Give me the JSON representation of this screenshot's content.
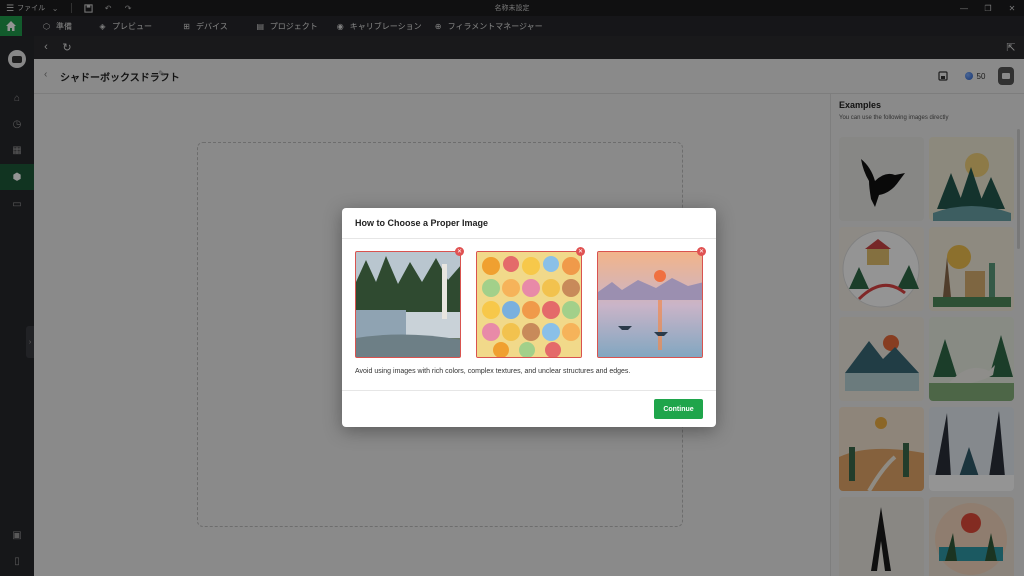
{
  "titlebar": {
    "file_menu_label": "ファイル",
    "window_title": "名称未設定"
  },
  "toolbar": {
    "items": [
      {
        "label": "準備",
        "icon": "cube-icon"
      },
      {
        "label": "プレビュー",
        "icon": "layers-icon"
      },
      {
        "label": "デバイス",
        "icon": "device-icon"
      },
      {
        "label": "プロジェクト",
        "icon": "project-icon"
      },
      {
        "label": "キャリブレーション",
        "icon": "calibration-icon"
      },
      {
        "label": "フィラメントマネージャー",
        "icon": "filament-icon"
      }
    ]
  },
  "page": {
    "title": "シャドーボックスドラフト",
    "credits": "50"
  },
  "examples": {
    "title": "Examples",
    "subtitle": "You can use the following images directly"
  },
  "modal": {
    "title": "How to Choose a Proper Image",
    "description": "Avoid using images with rich colors, complex textures, and unclear structures and edges.",
    "continue_label": "Continue",
    "bad_examples": [
      "waterfall-photo",
      "sticker-collage",
      "impressionist-painting"
    ]
  },
  "colors": {
    "accent_green": "#1fa54b",
    "warning_red": "#d9534f"
  }
}
